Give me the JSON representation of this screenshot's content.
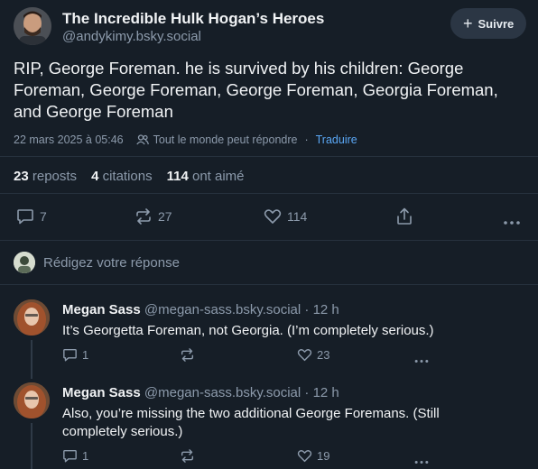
{
  "post": {
    "author_name": "The Incredible Hulk Hogan’s Heroes",
    "author_handle": "@andykimy.bsky.social",
    "follow_label": "Suivre",
    "text": "RIP, George Foreman. he is survived by his children: George Foreman, George Foreman, George Foreman, Georgia Foreman, and George Foreman",
    "date": "22 mars 2025 à 05:46",
    "audience": "Tout le monde peut répondre",
    "translate": "Traduire",
    "stats": {
      "reposts_count": "23",
      "reposts_label": "reposts",
      "quotes_count": "4",
      "quotes_label": "citations",
      "likes_count": "114",
      "likes_label": "ont aimé"
    },
    "actions": {
      "reply_count": "7",
      "repost_count": "27",
      "like_count": "114"
    }
  },
  "composer": {
    "placeholder": "Rédigez votre réponse"
  },
  "replies": [
    {
      "name": "Megan Sass",
      "handle": "@megan-sass.bsky.social",
      "time": "· 12 h",
      "text": "It’s Georgetta Foreman, not Georgia. (I’m completely serious.)",
      "reply_count": "1",
      "like_count": "23"
    },
    {
      "name": "Megan Sass",
      "handle": "@megan-sass.bsky.social",
      "time": "· 12 h",
      "text": "Also, you’re missing the two additional George Foremans. (Still completely serious.)",
      "reply_count": "1",
      "like_count": "19"
    }
  ],
  "colors": {
    "background": "#161e27",
    "accent": "#5aa7f5",
    "muted": "#8c9aab"
  }
}
